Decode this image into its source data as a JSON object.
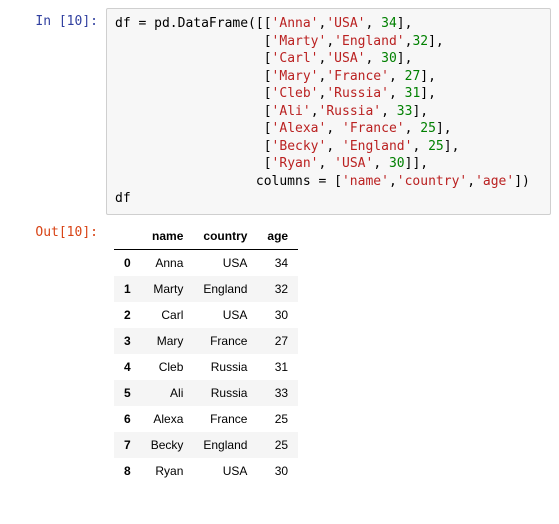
{
  "prompts": {
    "in": "In [10]:",
    "out": "Out[10]:"
  },
  "code_tokens": [
    {
      "t": "plain",
      "s": "df = pd.DataFrame([["
    },
    {
      "t": "str",
      "s": "'Anna'"
    },
    {
      "t": "plain",
      "s": ","
    },
    {
      "t": "str",
      "s": "'USA'"
    },
    {
      "t": "plain",
      "s": ", "
    },
    {
      "t": "num",
      "s": "34"
    },
    {
      "t": "plain",
      "s": "],\n                   ["
    },
    {
      "t": "str",
      "s": "'Marty'"
    },
    {
      "t": "plain",
      "s": ","
    },
    {
      "t": "str",
      "s": "'England'"
    },
    {
      "t": "plain",
      "s": ","
    },
    {
      "t": "num",
      "s": "32"
    },
    {
      "t": "plain",
      "s": "],\n                   ["
    },
    {
      "t": "str",
      "s": "'Carl'"
    },
    {
      "t": "plain",
      "s": ","
    },
    {
      "t": "str",
      "s": "'USA'"
    },
    {
      "t": "plain",
      "s": ", "
    },
    {
      "t": "num",
      "s": "30"
    },
    {
      "t": "plain",
      "s": "],\n                   ["
    },
    {
      "t": "str",
      "s": "'Mary'"
    },
    {
      "t": "plain",
      "s": ","
    },
    {
      "t": "str",
      "s": "'France'"
    },
    {
      "t": "plain",
      "s": ", "
    },
    {
      "t": "num",
      "s": "27"
    },
    {
      "t": "plain",
      "s": "],\n                   ["
    },
    {
      "t": "str",
      "s": "'Cleb'"
    },
    {
      "t": "plain",
      "s": ","
    },
    {
      "t": "str",
      "s": "'Russia'"
    },
    {
      "t": "plain",
      "s": ", "
    },
    {
      "t": "num",
      "s": "31"
    },
    {
      "t": "plain",
      "s": "],\n                   ["
    },
    {
      "t": "str",
      "s": "'Ali'"
    },
    {
      "t": "plain",
      "s": ","
    },
    {
      "t": "str",
      "s": "'Russia'"
    },
    {
      "t": "plain",
      "s": ", "
    },
    {
      "t": "num",
      "s": "33"
    },
    {
      "t": "plain",
      "s": "],\n                   ["
    },
    {
      "t": "str",
      "s": "'Alexa'"
    },
    {
      "t": "plain",
      "s": ", "
    },
    {
      "t": "str",
      "s": "'France'"
    },
    {
      "t": "plain",
      "s": ", "
    },
    {
      "t": "num",
      "s": "25"
    },
    {
      "t": "plain",
      "s": "],\n                   ["
    },
    {
      "t": "str",
      "s": "'Becky'"
    },
    {
      "t": "plain",
      "s": ", "
    },
    {
      "t": "str",
      "s": "'England'"
    },
    {
      "t": "plain",
      "s": ", "
    },
    {
      "t": "num",
      "s": "25"
    },
    {
      "t": "plain",
      "s": "],\n                   ["
    },
    {
      "t": "str",
      "s": "'Ryan'"
    },
    {
      "t": "plain",
      "s": ", "
    },
    {
      "t": "str",
      "s": "'USA'"
    },
    {
      "t": "plain",
      "s": ", "
    },
    {
      "t": "num",
      "s": "30"
    },
    {
      "t": "plain",
      "s": "]],\n                  columns = ["
    },
    {
      "t": "str",
      "s": "'name'"
    },
    {
      "t": "plain",
      "s": ","
    },
    {
      "t": "str",
      "s": "'country'"
    },
    {
      "t": "plain",
      "s": ","
    },
    {
      "t": "str",
      "s": "'age'"
    },
    {
      "t": "plain",
      "s": "])\ndf"
    }
  ],
  "table": {
    "columns": [
      "name",
      "country",
      "age"
    ],
    "rows": [
      {
        "idx": "0",
        "name": "Anna",
        "country": "USA",
        "age": "34"
      },
      {
        "idx": "1",
        "name": "Marty",
        "country": "England",
        "age": "32"
      },
      {
        "idx": "2",
        "name": "Carl",
        "country": "USA",
        "age": "30"
      },
      {
        "idx": "3",
        "name": "Mary",
        "country": "France",
        "age": "27"
      },
      {
        "idx": "4",
        "name": "Cleb",
        "country": "Russia",
        "age": "31"
      },
      {
        "idx": "5",
        "name": "Ali",
        "country": "Russia",
        "age": "33"
      },
      {
        "idx": "6",
        "name": "Alexa",
        "country": "France",
        "age": "25"
      },
      {
        "idx": "7",
        "name": "Becky",
        "country": "England",
        "age": "25"
      },
      {
        "idx": "8",
        "name": "Ryan",
        "country": "USA",
        "age": "30"
      }
    ]
  }
}
